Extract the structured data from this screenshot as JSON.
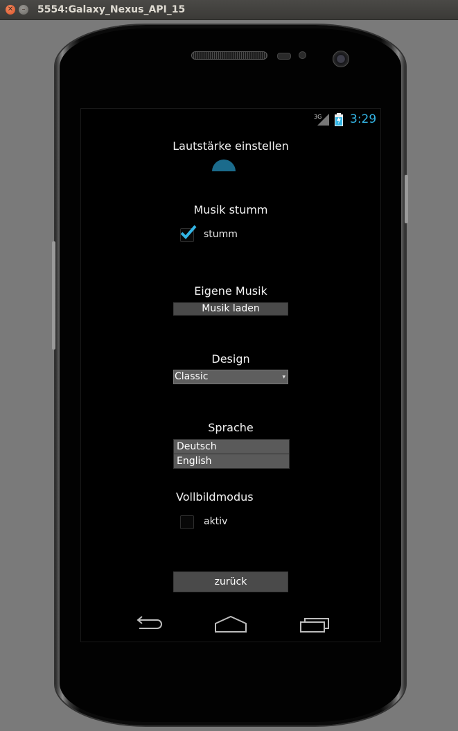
{
  "window": {
    "title": "5554:Galaxy_Nexus_API_15"
  },
  "statusbar": {
    "network": "3G",
    "time": "3:29"
  },
  "settings": {
    "volume": {
      "heading": "Lautstärke einstellen"
    },
    "mute": {
      "heading": "Musik stumm",
      "checkbox_label": "stumm",
      "checked": true
    },
    "music": {
      "heading": "Eigene Musik",
      "button_label": "Musik laden"
    },
    "design": {
      "heading": "Design",
      "selected": "Classic"
    },
    "language": {
      "heading": "Sprache",
      "options": [
        "Deutsch",
        "English"
      ]
    },
    "fullscreen": {
      "heading": "Vollbildmodus",
      "checkbox_label": "aktiv",
      "checked": false
    },
    "back_label": "zurück"
  },
  "colors": {
    "accent": "#33b5e5",
    "check": "#33b5e5",
    "spinner": "#1b6b8c"
  },
  "icons": [
    "back-icon",
    "home-icon",
    "recent-apps-icon",
    "signal-icon",
    "battery-icon",
    "checkmark-icon"
  ]
}
